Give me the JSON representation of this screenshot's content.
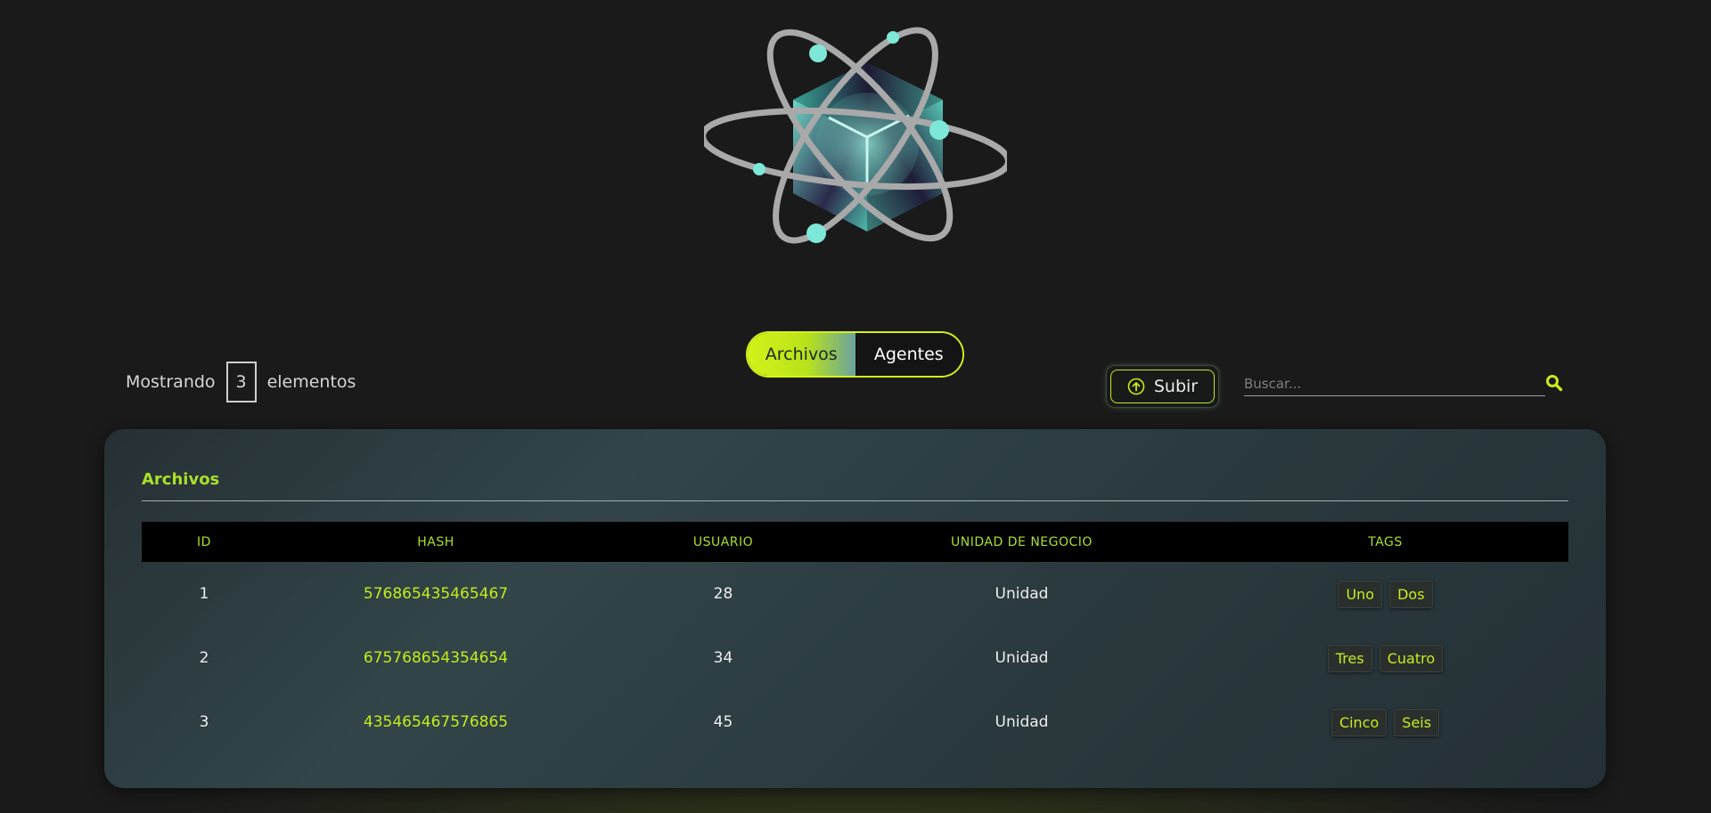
{
  "toggle": {
    "archivos": "Archivos",
    "agentes": "Agentes"
  },
  "count": {
    "prefix": "Mostrando",
    "value": "3",
    "suffix": "elementos"
  },
  "upload": {
    "label": "Subir",
    "icon": "arrow-up-circle-icon"
  },
  "search": {
    "placeholder": "Buscar...",
    "icon": "search-icon"
  },
  "panel": {
    "title": "Archivos"
  },
  "table": {
    "columns": [
      "ID",
      "HASH",
      "USUARIO",
      "UNIDAD DE NEGOCIO",
      "TAGS"
    ],
    "rows": [
      {
        "id": "1",
        "hash": "576865435465467",
        "usuario": "28",
        "unidad": "Unidad",
        "tags": [
          "Uno",
          "Dos"
        ]
      },
      {
        "id": "2",
        "hash": "675768654354654",
        "usuario": "34",
        "unidad": "Unidad",
        "tags": [
          "Tres",
          "Cuatro"
        ]
      },
      {
        "id": "3",
        "hash": "435465467576865",
        "usuario": "45",
        "unidad": "Unidad",
        "tags": [
          "Cinco",
          "Seis"
        ]
      }
    ]
  },
  "colors": {
    "accent": "#c8ec1a",
    "heading": "#a8e02a",
    "teal": "#7ee8d8",
    "background": "#1a1a1a"
  }
}
